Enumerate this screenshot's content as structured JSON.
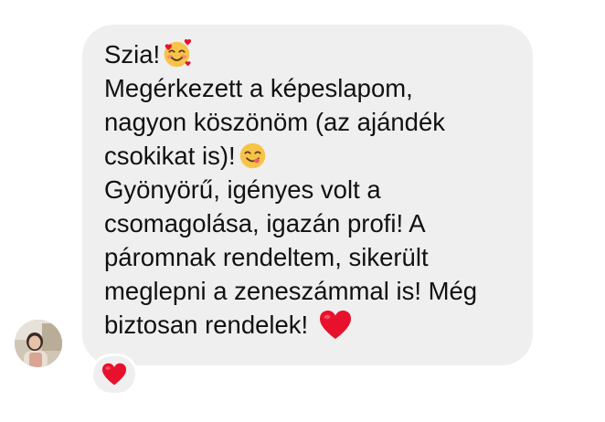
{
  "message": {
    "lines": [
      {
        "text": "Szia!",
        "emoji": "smiling-face-with-hearts-icon"
      },
      {
        "text": "Megérkezett a képeslapom,"
      },
      {
        "text": "nagyon köszönöm (az ajándék"
      },
      {
        "text": "csokikat is)!",
        "emoji": "face-savoring-food-icon"
      },
      {
        "text": "Gyönyörű, igényes volt a"
      },
      {
        "text": "csomagolása, igazán profi! A"
      },
      {
        "text": "páromnak rendeltem, sikerült"
      },
      {
        "text": "meglepni a zeneszámmal is! Még"
      },
      {
        "text": "biztosan rendelek!",
        "emoji": "red-heart-icon"
      }
    ],
    "bubble_color": "#efefef",
    "text_color": "#111111"
  },
  "reaction": {
    "emoji": "red-heart-icon",
    "color": "#e8112d"
  },
  "sender": {
    "avatar": "profile-photo"
  }
}
